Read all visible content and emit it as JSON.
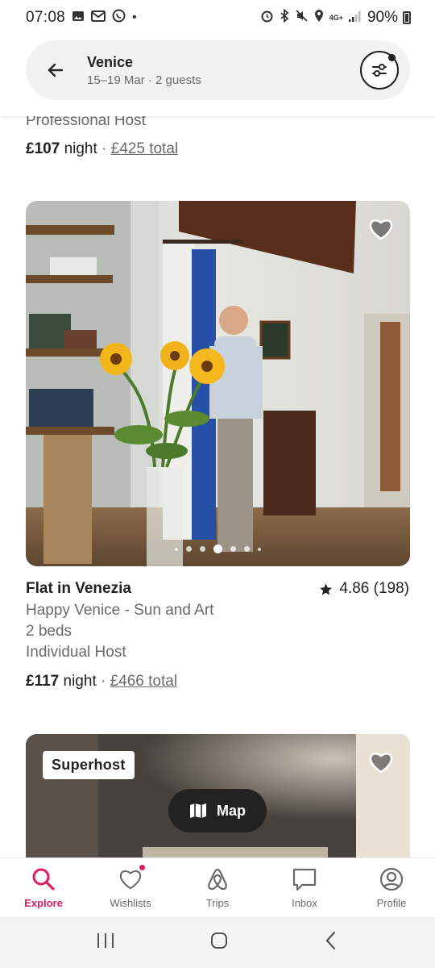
{
  "status_bar": {
    "time": "07:08",
    "dot": "•",
    "left_icons": [
      "gallery-icon",
      "gmail-icon",
      "whatsapp-icon"
    ],
    "right_icons": [
      "alarm-icon",
      "bluetooth-icon",
      "mute-icon",
      "location-icon",
      "network-4g-icon",
      "signal-icon"
    ],
    "network": "4G+",
    "battery": "90%"
  },
  "search": {
    "title": "Venice",
    "subtitle": "15–19 Mar · 2 guests"
  },
  "previous_listing": {
    "host_type": "Professional Host",
    "price": "£107",
    "price_unit": "night",
    "separator": "·",
    "total": "£425 total"
  },
  "listing": {
    "title": "Flat in Venezia",
    "rating": "4.86 (198)",
    "description": "Happy Venice - Sun and Art",
    "beds": "2 beds",
    "host_type": "Individual Host",
    "price": "£117",
    "price_unit": "night",
    "separator": "·",
    "total": "£466 total",
    "photo_count_dots": 7,
    "active_photo_index": 3
  },
  "next_listing": {
    "badge": "Superhost"
  },
  "map_button": {
    "label": "Map"
  },
  "bottom_nav": {
    "items": [
      {
        "label": "Explore",
        "icon": "search-icon",
        "active": true
      },
      {
        "label": "Wishlists",
        "icon": "heart-icon",
        "badge": true
      },
      {
        "label": "Trips",
        "icon": "airbnb-logo-icon"
      },
      {
        "label": "Inbox",
        "icon": "message-icon"
      },
      {
        "label": "Profile",
        "icon": "profile-icon"
      }
    ]
  },
  "colors": {
    "brand": "#e31c5f",
    "text": "#222222",
    "muted": "#6a6a6a"
  }
}
